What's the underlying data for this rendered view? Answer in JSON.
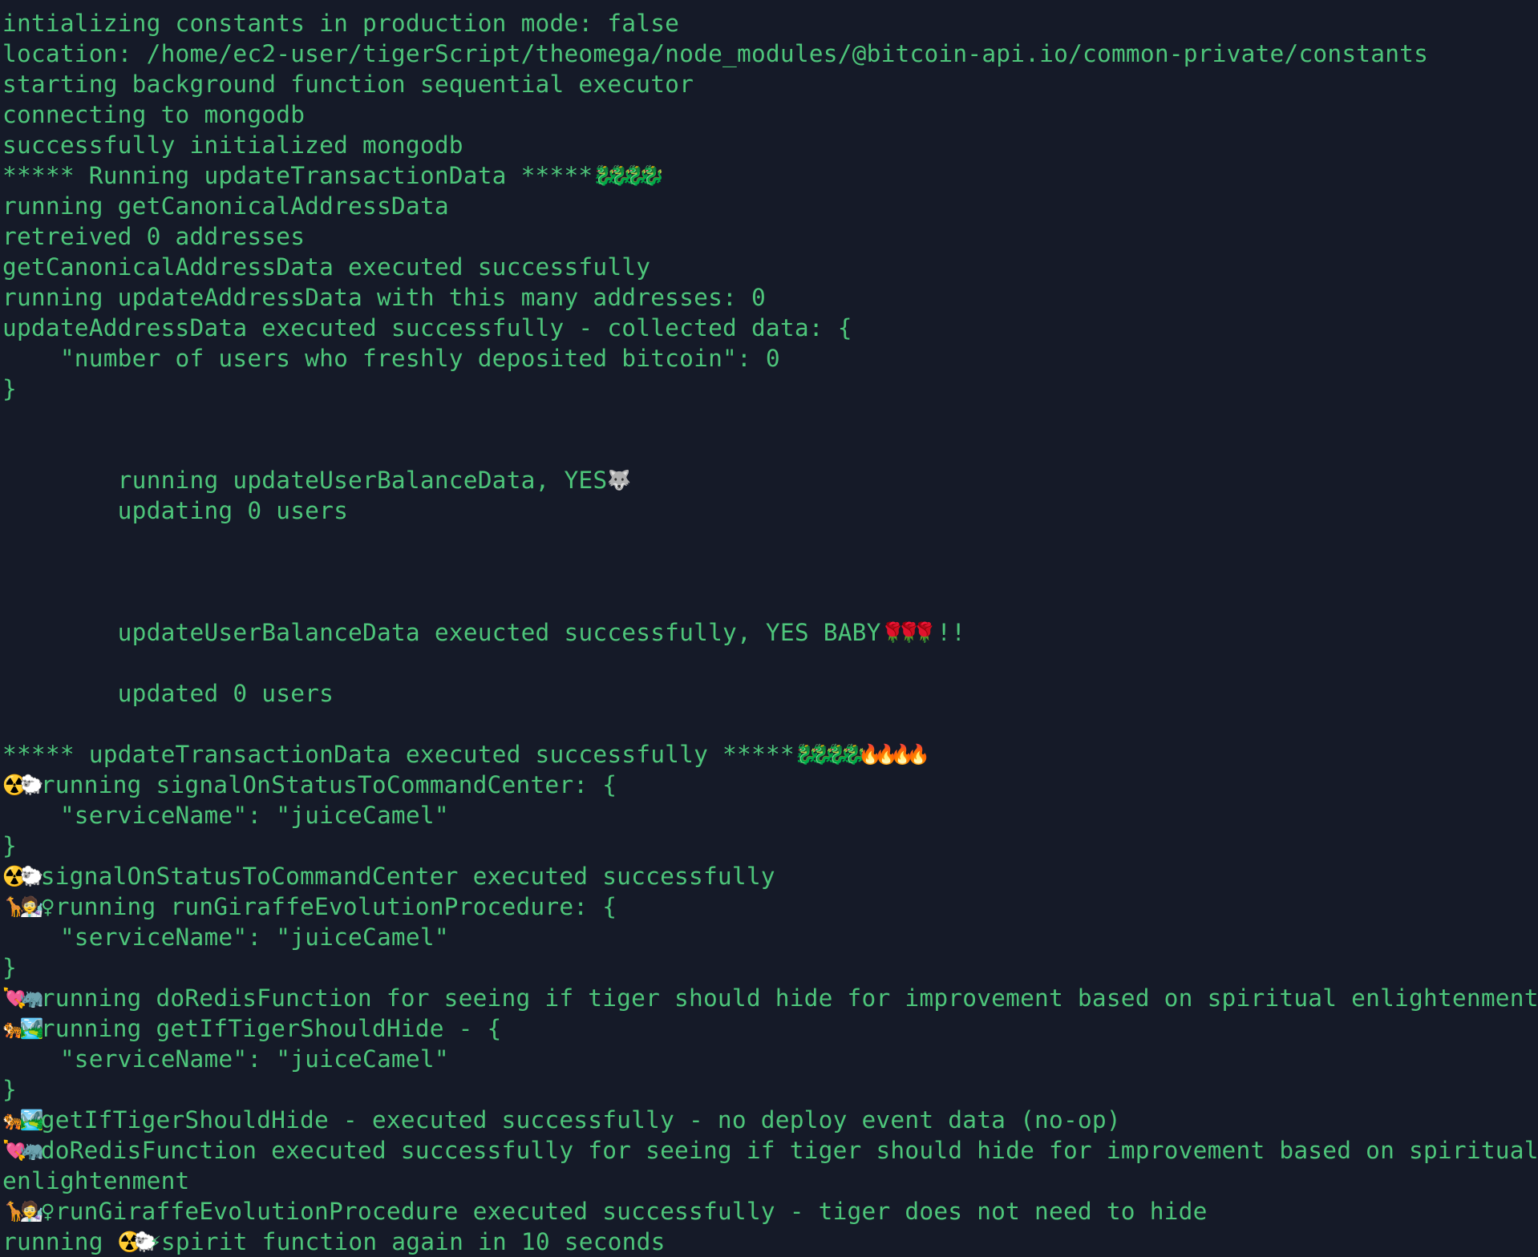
{
  "terminal": {
    "background_color": "#151a28",
    "text_color": "#4dc57a",
    "lines": [
      {
        "prefix_icons": "",
        "text": "intializing constants in production mode: false",
        "suffix_icons": ""
      },
      {
        "prefix_icons": "",
        "text": "location: /home/ec2-user/tigerScript/theomega/node_modules/@bitcoin-api.io/common-private/constants",
        "suffix_icons": ""
      },
      {
        "prefix_icons": "",
        "text": "starting background function sequential executor",
        "suffix_icons": ""
      },
      {
        "prefix_icons": "",
        "text": "connecting to mongodb",
        "suffix_icons": ""
      },
      {
        "prefix_icons": "",
        "text": "successfully initialized mongodb",
        "suffix_icons": ""
      },
      {
        "prefix_icons": "",
        "text": "***** Running updateTransactionData *****",
        "suffix_icons": "🐉🐉🐉🐉"
      },
      {
        "prefix_icons": "",
        "text": "running getCanonicalAddressData",
        "suffix_icons": ""
      },
      {
        "prefix_icons": "",
        "text": "retreived 0 addresses",
        "suffix_icons": ""
      },
      {
        "prefix_icons": "",
        "text": "getCanonicalAddressData executed successfully",
        "suffix_icons": ""
      },
      {
        "prefix_icons": "",
        "text": "running updateAddressData with this many addresses: 0",
        "suffix_icons": ""
      },
      {
        "prefix_icons": "",
        "text": "updateAddressData executed successfully - collected data: {",
        "suffix_icons": ""
      },
      {
        "prefix_icons": "",
        "text": "    \"number of users who freshly deposited bitcoin\": 0",
        "suffix_icons": ""
      },
      {
        "prefix_icons": "",
        "text": "}",
        "suffix_icons": ""
      },
      {
        "prefix_icons": "",
        "text": "",
        "suffix_icons": ""
      },
      {
        "prefix_icons": "",
        "text": "",
        "suffix_icons": ""
      },
      {
        "prefix_icons": "",
        "text": "        running updateUserBalanceData, YES",
        "suffix_icons": "🐺"
      },
      {
        "prefix_icons": "",
        "text": "        updating 0 users",
        "suffix_icons": ""
      },
      {
        "prefix_icons": "",
        "text": "",
        "suffix_icons": ""
      },
      {
        "prefix_icons": "",
        "text": "",
        "suffix_icons": ""
      },
      {
        "prefix_icons": "",
        "text": "",
        "suffix_icons": ""
      },
      {
        "prefix_icons": "",
        "text": "        updateUserBalanceData exeucted successfully, YES BABY",
        "suffix_icons": "🌹🌹🌹",
        "suffix_text": "!!"
      },
      {
        "prefix_icons": "",
        "text": "",
        "suffix_icons": ""
      },
      {
        "prefix_icons": "",
        "text": "        updated 0 users",
        "suffix_icons": ""
      },
      {
        "prefix_icons": "",
        "text": "",
        "suffix_icons": ""
      },
      {
        "prefix_icons": "",
        "text": "***** updateTransactionData executed successfully *****",
        "suffix_icons": "🐉🐉🐉🐉🔥🔥🔥🔥"
      },
      {
        "prefix_icons": "☢️🐑",
        "text": "running signalOnStatusToCommandCenter: {",
        "suffix_icons": ""
      },
      {
        "prefix_icons": "",
        "text": "    \"serviceName\": \"juiceCamel\"",
        "suffix_icons": ""
      },
      {
        "prefix_icons": "",
        "text": "}",
        "suffix_icons": ""
      },
      {
        "prefix_icons": "☢️🐑",
        "text": "signalOnStatusToCommandCenter executed successfully",
        "suffix_icons": ""
      },
      {
        "prefix_icons": "🦒🧑‍🔬",
        "text": "♀running runGiraffeEvolutionProcedure: {",
        "suffix_icons": ""
      },
      {
        "prefix_icons": "",
        "text": "    \"serviceName\": \"juiceCamel\"",
        "suffix_icons": ""
      },
      {
        "prefix_icons": "",
        "text": "}",
        "suffix_icons": ""
      },
      {
        "prefix_icons": "💘🦏",
        "text": "running doRedisFunction for seeing if tiger should hide for improvement based on spiritual enlightenment",
        "suffix_icons": ""
      },
      {
        "prefix_icons": "🐅🏞️",
        "text": "running getIfTigerShouldHide - {",
        "suffix_icons": ""
      },
      {
        "prefix_icons": "",
        "text": "    \"serviceName\": \"juiceCamel\"",
        "suffix_icons": ""
      },
      {
        "prefix_icons": "",
        "text": "}",
        "suffix_icons": ""
      },
      {
        "prefix_icons": "🐅🏞️",
        "text": "getIfTigerShouldHide - executed successfully - no deploy event data (no-op)",
        "suffix_icons": ""
      },
      {
        "prefix_icons": "💘🦏",
        "text": "doRedisFunction executed successfully for seeing if tiger should hide for improvement based on spiritual",
        "suffix_icons": ""
      },
      {
        "prefix_icons": "",
        "text": "enlightenment",
        "suffix_icons": ""
      },
      {
        "prefix_icons": "🦒🧑‍🔬",
        "text": "♀runGiraffeEvolutionProcedure executed successfully - tiger does not need to hide",
        "suffix_icons": ""
      },
      {
        "prefix_icons": "",
        "text": "running ",
        "suffix_icons": "☢️🐑⚡",
        "suffix_text": "spirit function again in 10 seconds"
      }
    ]
  }
}
